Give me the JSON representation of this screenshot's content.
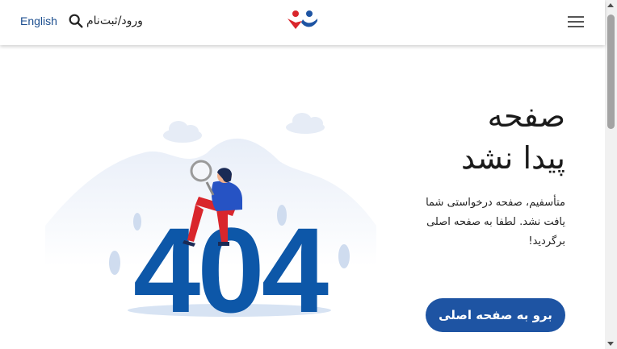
{
  "header": {
    "language_link": "English",
    "login_label": "ورود/ثبت‌نام",
    "icons": {
      "search": "search-icon",
      "logo": "brand-logo",
      "menu": "hamburger-menu-icon"
    }
  },
  "main": {
    "title_line1": "صفحه",
    "title_line2": "پیدا نشد",
    "description": "متأسفیم، صفحه درخواستی شما یافت نشد. لطفا به صفحه اصلی برگردید!",
    "home_button": "برو به صفحه اصلی",
    "illustration": {
      "code": "404"
    }
  },
  "colors": {
    "brand_blue": "#1e54a3",
    "brand_red": "#d9262c",
    "digits_blue": "#0d57a8",
    "link_blue": "#1d4f8f"
  }
}
